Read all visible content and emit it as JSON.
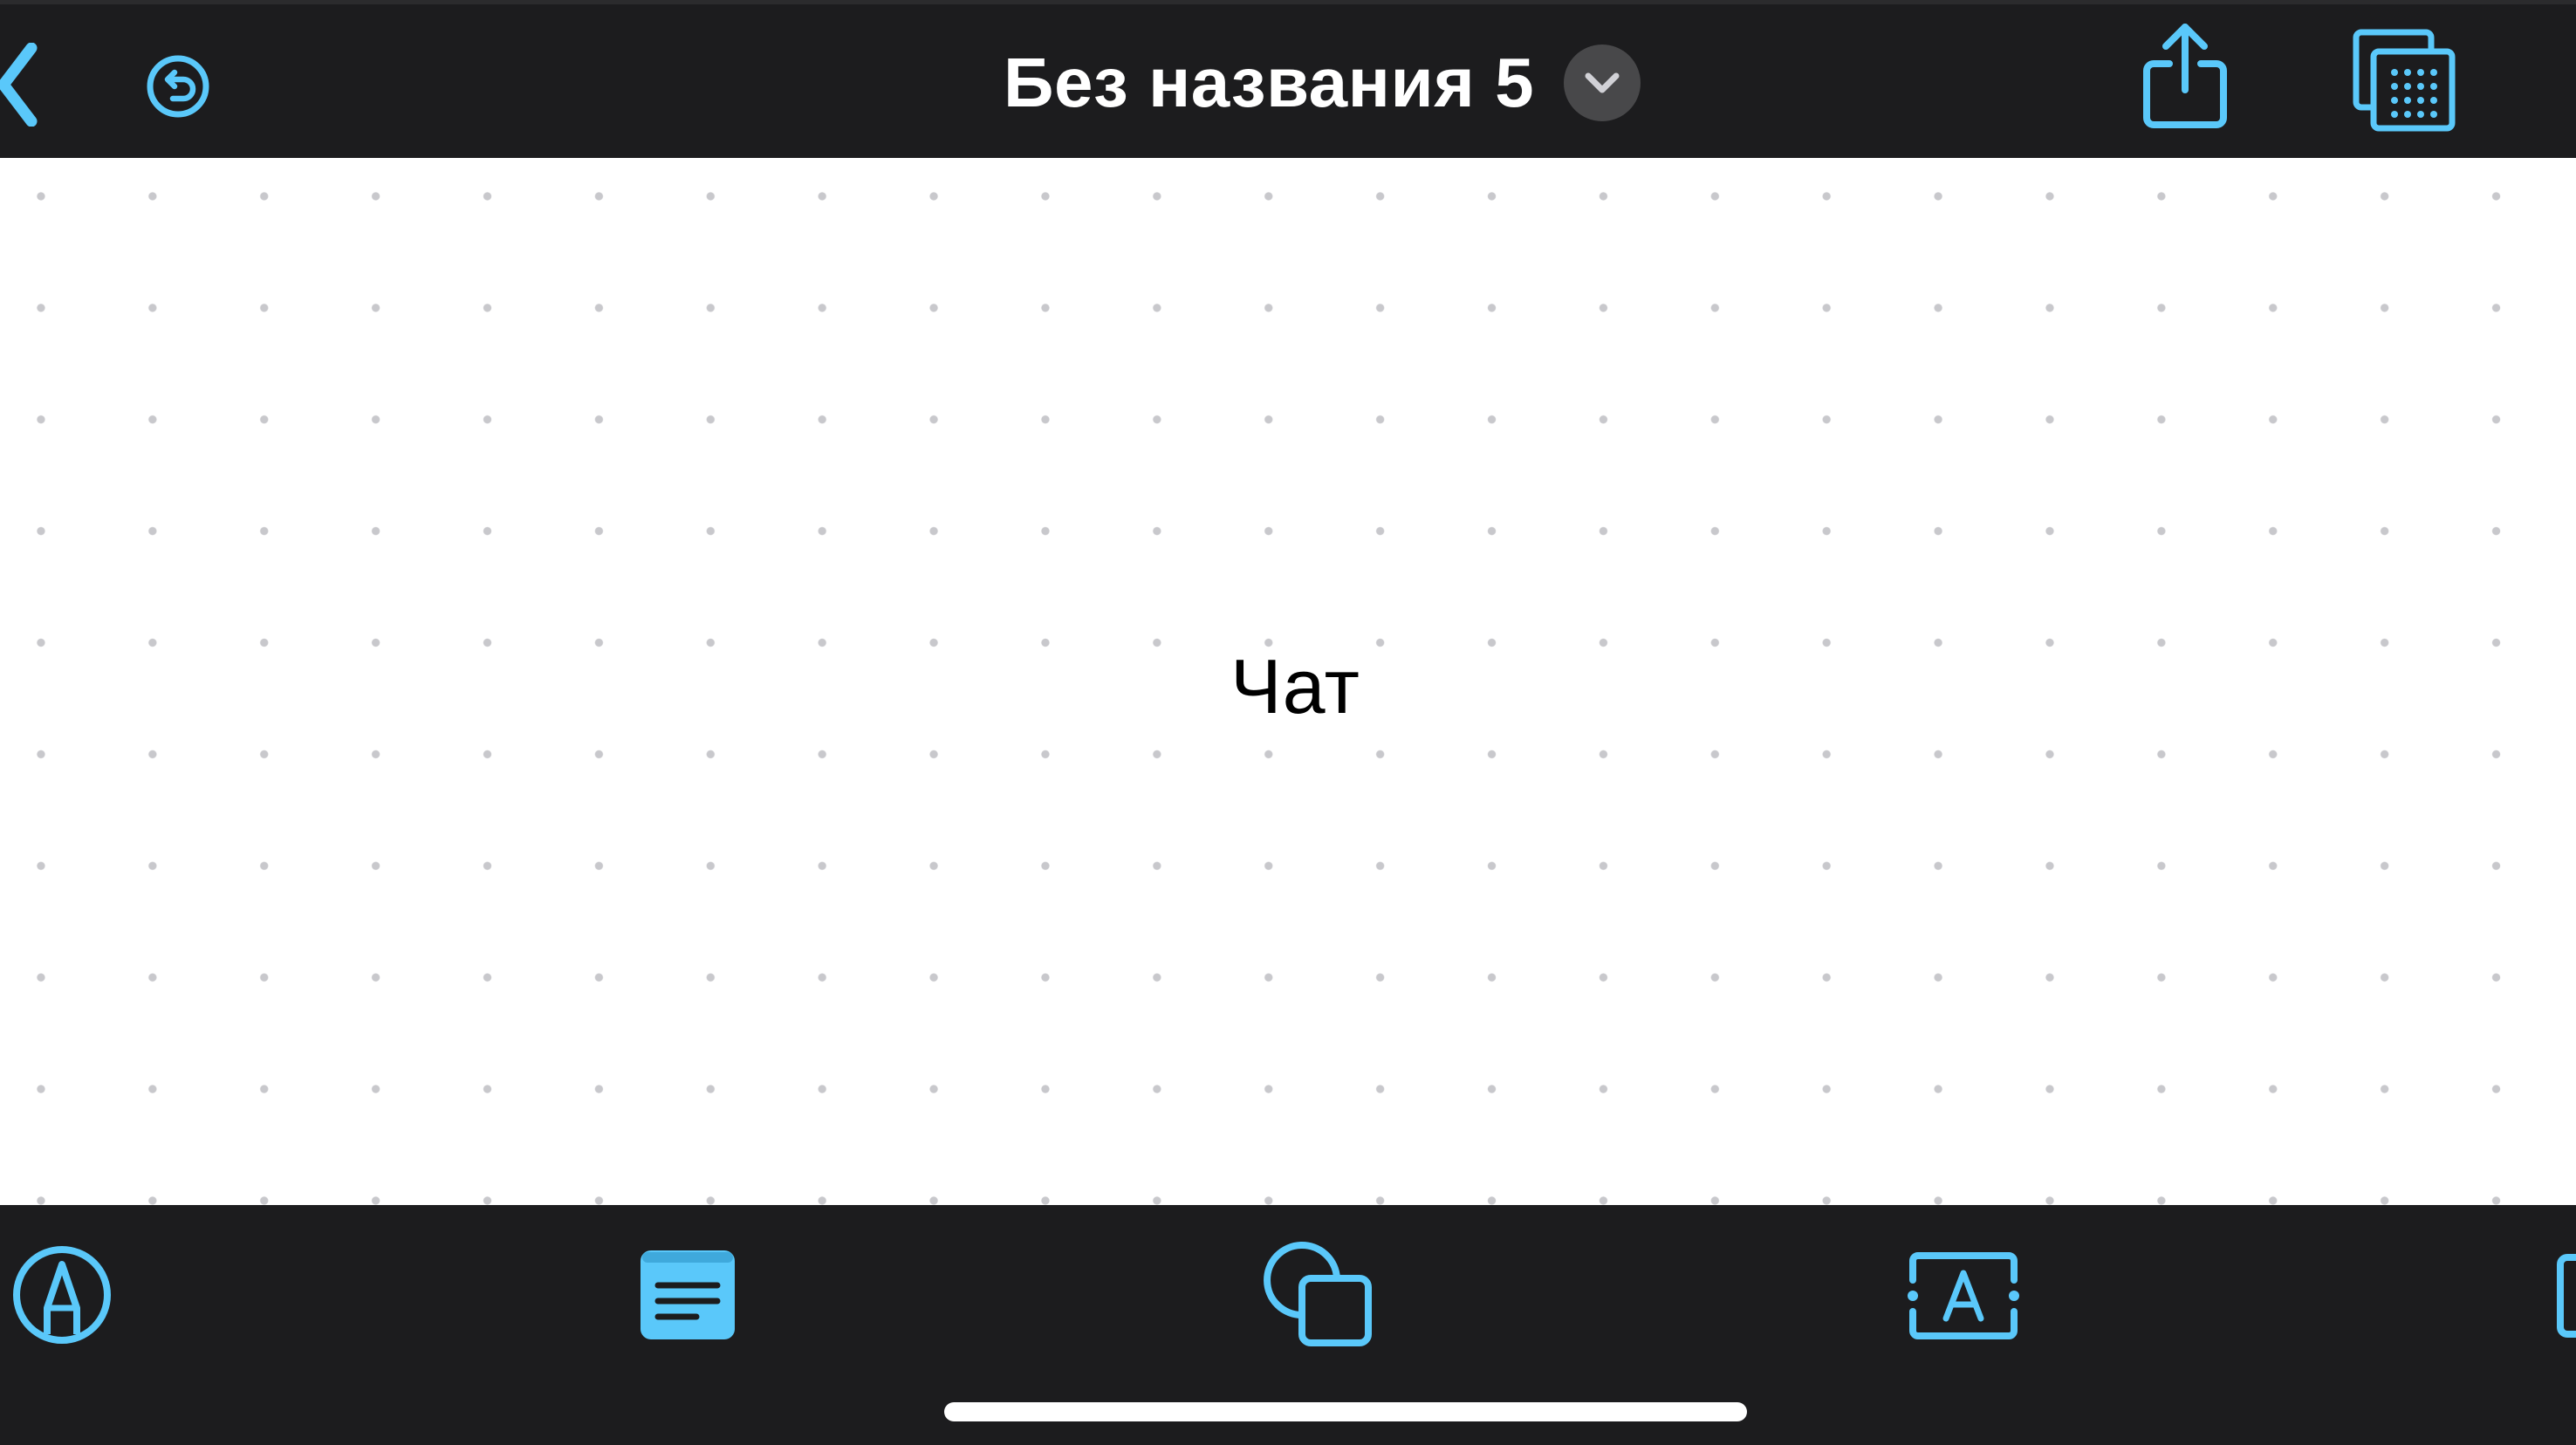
{
  "header": {
    "back_icon": "chevron-left-icon",
    "undo_icon": "undo-icon",
    "title": "Без названия 5",
    "title_menu_icon": "chevron-down-icon",
    "share_icon": "share-icon",
    "board_browser_icon": "boards-grid-icon"
  },
  "canvas": {
    "background": "dot-grid",
    "text_items": [
      {
        "text": "Чат"
      }
    ]
  },
  "toolbar": {
    "items": [
      {
        "icon": "pen-tool-icon"
      },
      {
        "icon": "sticky-note-icon"
      },
      {
        "icon": "shapes-icon"
      },
      {
        "icon": "text-box-icon"
      },
      {
        "icon": "more-tool-icon"
      }
    ]
  },
  "colors": {
    "accent": "#5ac8fa",
    "bar_background": "#1c1c1e",
    "canvas_background": "#ffffff",
    "grid_dot": "#c8c8cc"
  }
}
